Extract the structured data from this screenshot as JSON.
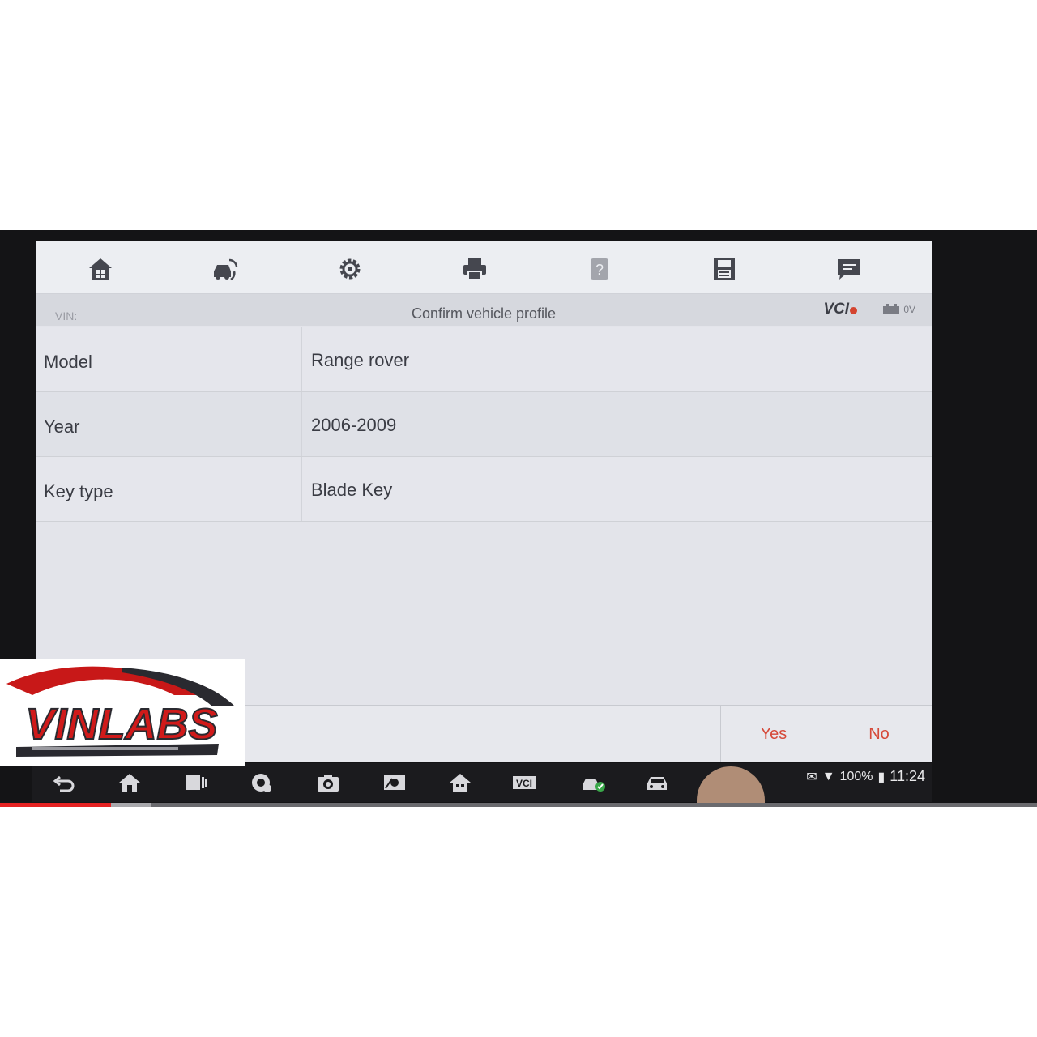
{
  "toolbar": {
    "icons": [
      "home-icon",
      "vehicle-swap-icon",
      "gear-icon",
      "printer-icon",
      "help-icon",
      "save-icon",
      "chat-icon"
    ]
  },
  "titlebar": {
    "vin_label": "VIN:",
    "title": "Confirm vehicle profile",
    "vci_label": "VCI",
    "battery_voltage": "0V"
  },
  "profile": {
    "rows": [
      {
        "label": "Model",
        "value": "Range rover"
      },
      {
        "label": "Year",
        "value": "2006-2009"
      },
      {
        "label": "Key type",
        "value": "Blade Key"
      }
    ]
  },
  "footer": {
    "yes_label": "Yes",
    "no_label": "No"
  },
  "navbar": {
    "vci_label": "VCI",
    "battery_percent": "100%",
    "time": "11:24"
  },
  "video": {
    "progress": 0.107,
    "buffered": 0.145
  },
  "logo": {
    "text": "VINLABS"
  },
  "colors": {
    "accent": "#d64a3a",
    "screen_bg": "#e3e4ea",
    "bezel": "#141416"
  }
}
